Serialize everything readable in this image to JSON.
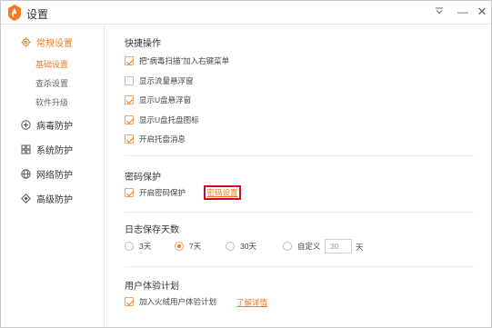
{
  "window": {
    "title": "设置"
  },
  "titlebar": {
    "menu_glyph": "⩢",
    "minimize_glyph": "—",
    "close_glyph": "✕"
  },
  "colors": {
    "accent": "#f47a1f",
    "highlight_box": "#c8102e"
  },
  "sidebar": {
    "items": [
      {
        "label": "常规设置",
        "icon": "gear-icon",
        "active": true
      },
      {
        "label": "病毒防护",
        "icon": "plus-circle-icon",
        "active": false
      },
      {
        "label": "系统防护",
        "icon": "grid-icon",
        "active": false
      },
      {
        "label": "网络防护",
        "icon": "globe-icon",
        "active": false
      },
      {
        "label": "高级防护",
        "icon": "diamond-icon",
        "active": false
      }
    ],
    "sub_items": [
      {
        "label": "基础设置",
        "active": true
      },
      {
        "label": "查杀设置",
        "active": false
      },
      {
        "label": "软件升级",
        "active": false
      }
    ]
  },
  "shortcuts": {
    "title": "快捷操作",
    "options": [
      {
        "label": "把“病毒扫描”加入右键菜单",
        "checked": true
      },
      {
        "label": "显示流量悬浮窗",
        "checked": false
      },
      {
        "label": "显示U盘悬浮窗",
        "checked": true
      },
      {
        "label": "显示U盘托盘图标",
        "checked": true
      },
      {
        "label": "开启托盘消息",
        "checked": true
      }
    ]
  },
  "password": {
    "title": "密码保护",
    "enable_label": "开启密码保护",
    "enable_checked": true,
    "settings_link": "密码设置"
  },
  "log_retention": {
    "title": "日志保存天数",
    "options": [
      {
        "label": "3天",
        "checked": false
      },
      {
        "label": "7天",
        "checked": true
      },
      {
        "label": "30天",
        "checked": false
      },
      {
        "label": "自定义",
        "checked": false
      }
    ],
    "custom_value": "30",
    "unit": "天"
  },
  "ux_plan": {
    "title": "用户体验计划",
    "join_label": "加入火绒用户体验计划",
    "join_checked": true,
    "details_link": "了解详情"
  }
}
